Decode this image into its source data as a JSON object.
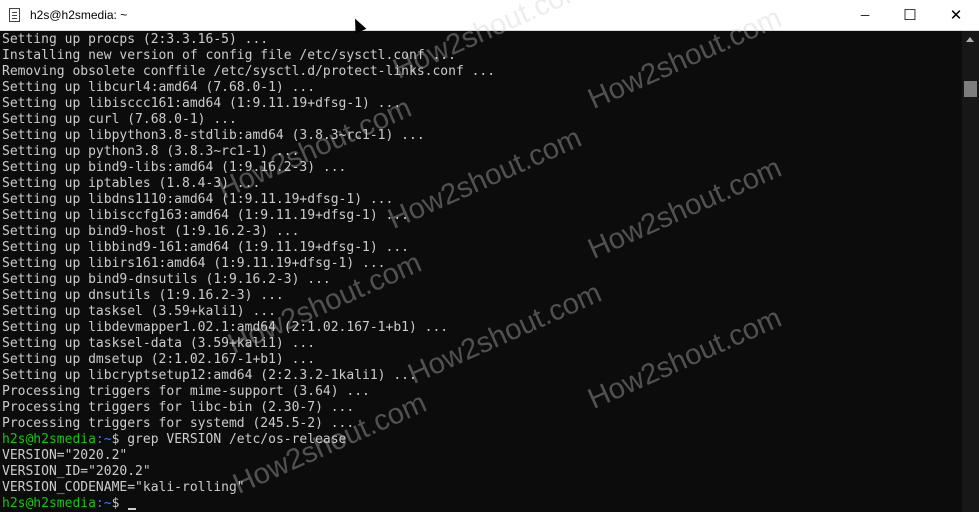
{
  "window": {
    "title": "h2s@h2smedia: ~",
    "controls": {
      "minimize_icon": "─",
      "maximize_icon": "☐",
      "close_icon": "✕"
    }
  },
  "terminal": {
    "lines": [
      "Setting up procps (2:3.3.16-5) ...",
      "Installing new version of config file /etc/sysctl.conf ...",
      "Removing obsolete conffile /etc/sysctl.d/protect-links.conf ...",
      "Setting up libcurl4:amd64 (7.68.0-1) ...",
      "Setting up libisccc161:amd64 (1:9.11.19+dfsg-1) ...",
      "Setting up curl (7.68.0-1) ...",
      "Setting up libpython3.8-stdlib:amd64 (3.8.3~rc1-1) ...",
      "Setting up python3.8 (3.8.3~rc1-1) ...",
      "Setting up bind9-libs:amd64 (1:9.16.2-3) ...",
      "Setting up iptables (1.8.4-3) ...",
      "Setting up libdns1110:amd64 (1:9.11.19+dfsg-1) ...",
      "Setting up libisccfg163:amd64 (1:9.11.19+dfsg-1) ...",
      "Setting up bind9-host (1:9.16.2-3) ...",
      "Setting up libbind9-161:amd64 (1:9.11.19+dfsg-1) ...",
      "Setting up libirs161:amd64 (1:9.11.19+dfsg-1) ...",
      "Setting up bind9-dnsutils (1:9.16.2-3) ...",
      "Setting up dnsutils (1:9.16.2-3) ...",
      "Setting up tasksel (3.59+kali1) ...",
      "Setting up libdevmapper1.02.1:amd64 (2:1.02.167-1+b1) ...",
      "Setting up tasksel-data (3.59+kali1) ...",
      "Setting up dmsetup (2:1.02.167-1+b1) ...",
      "Setting up libcryptsetup12:amd64 (2:2.3.2-1kali1) ...",
      "Processing triggers for mime-support (3.64) ...",
      "Processing triggers for libc-bin (2.30-7) ...",
      "Processing triggers for systemd (245.5-2) ..."
    ],
    "prompt_user_host": "h2s@h2smedia",
    "prompt_sep": ":",
    "prompt_path": "~",
    "prompt_symbol": "$",
    "command": " grep VERSION /etc/os-release",
    "output": [
      "VERSION=\"2020.2\"",
      "VERSION_ID=\"2020.2\"",
      "VERSION_CODENAME=\"kali-rolling\""
    ]
  },
  "watermark": {
    "text": "How2shout.com"
  }
}
